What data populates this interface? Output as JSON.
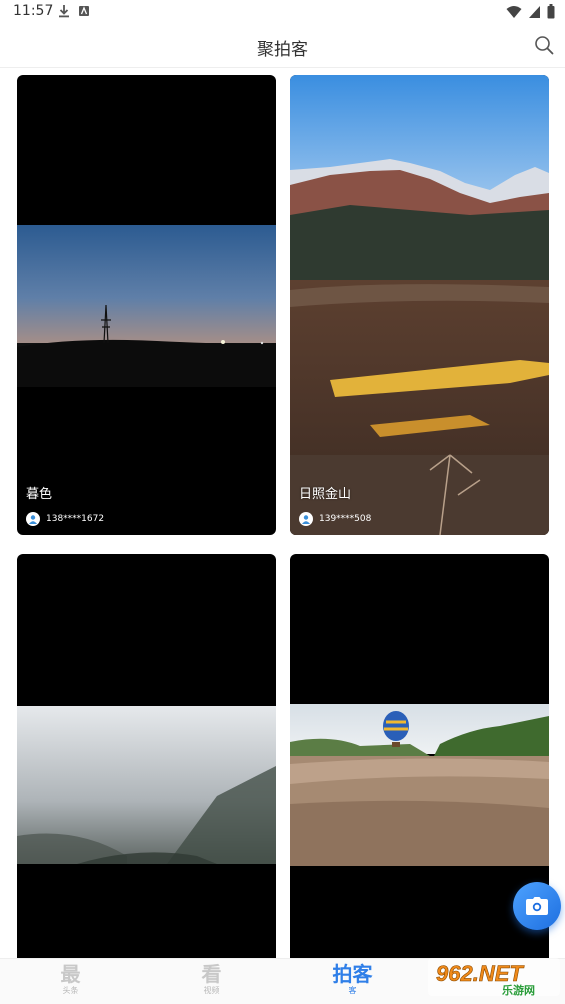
{
  "status_bar": {
    "time": "11:57",
    "left_icons": [
      "download-icon",
      "app-notification-icon"
    ],
    "right_icons": [
      "wifi-icon",
      "cellular-icon",
      "battery-icon"
    ]
  },
  "header": {
    "title": "聚拍客",
    "search_icon": "search-icon"
  },
  "cards": [
    {
      "title": "暮色",
      "author": "138****1672",
      "scene": "dusk-power-tower"
    },
    {
      "title": "日照金山",
      "author": "139****508",
      "scene": "snow-mountain"
    },
    {
      "title": "",
      "author": "",
      "scene": "foggy-valley"
    },
    {
      "title": "",
      "author": "",
      "scene": "hot-air-balloon-field"
    }
  ],
  "fab": {
    "icon": "camera-icon"
  },
  "tabs": [
    {
      "label": "最",
      "sub": "头条",
      "active": false
    },
    {
      "label": "看",
      "sub": "视频",
      "active": false
    },
    {
      "label": "拍客",
      "sub": "客",
      "active": true
    },
    {
      "label": "",
      "sub": "",
      "active": false
    }
  ],
  "watermark": {
    "brand": "962.NET",
    "sub": "乐游网"
  },
  "colors": {
    "accent": "#2f7fe8",
    "fab": "#1e6fe0",
    "card_bg": "#000000"
  }
}
